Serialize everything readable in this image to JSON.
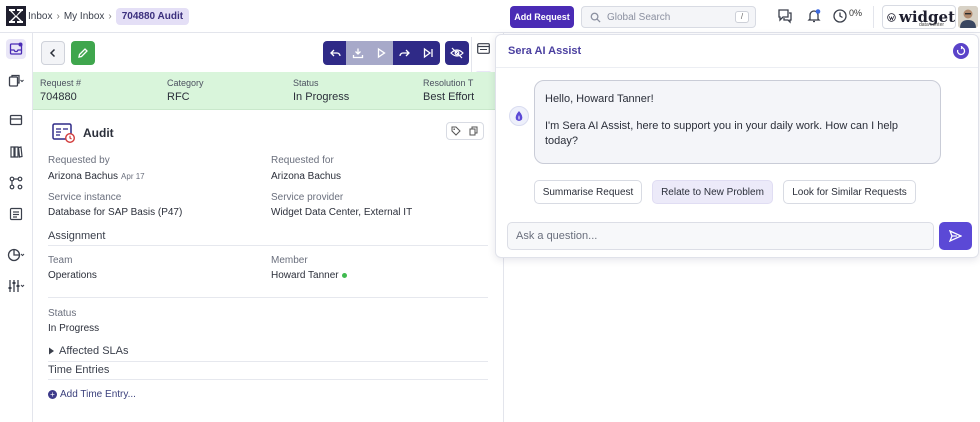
{
  "topbar": {
    "breadcrumbs": [
      "Inbox",
      "My Inbox"
    ],
    "current_ticket": "704880  Audit",
    "add_request_label": "Add Request",
    "search_placeholder": "Global Search",
    "search_shortcut": "/",
    "progress_pct": "0%",
    "brand_name": "widget",
    "brand_sub": "data center",
    "icons": [
      "chat-icon",
      "bell-icon",
      "clock-icon"
    ]
  },
  "rail": {
    "items": [
      "inbox-icon",
      "copy-icon",
      "cards-icon",
      "book-icon",
      "workflow-icon",
      "list-icon",
      "chart-icon",
      "sliders-icon"
    ]
  },
  "summary": {
    "request_label": "Request #",
    "request_value": "704880",
    "category_label": "Category",
    "category_value": "RFC",
    "status_label": "Status",
    "status_value": "In Progress",
    "resolution_label": "Resolution T",
    "resolution_value": "Best Effort"
  },
  "detail": {
    "title": "Audit",
    "requested_by_label": "Requested by",
    "requested_by_value": "Arizona Bachus",
    "requested_by_date": "Apr 17",
    "requested_for_label": "Requested for",
    "requested_for_value": "Arizona Bachus",
    "service_instance_label": "Service instance",
    "service_instance_value": "Database for SAP Basis (P47)",
    "service_provider_label": "Service provider",
    "service_provider_value": "Widget Data Center, External IT",
    "assignment_title": "Assignment",
    "team_label": "Team",
    "team_value": "Operations",
    "member_label": "Member",
    "member_value": "Howard Tanner",
    "status_label": "Status",
    "status_value": "In Progress",
    "affected_slas": "Affected SLAs",
    "time_entries": "Time Entries",
    "add_time_entry": "Add Time Entry..."
  },
  "sera": {
    "title": "Sera AI Assist",
    "greeting": "Hello, Howard Tanner!",
    "intro": "I'm Sera AI Assist, here to support you in your daily work. How can I help today?",
    "chips": [
      "Summarise Request",
      "Relate to New Problem",
      "Look for Similar Requests"
    ],
    "ask_placeholder": "Ask a question..."
  },
  "colors": {
    "accent": "#4a2bb5",
    "action_bar": "#2f2a87",
    "edit_green": "#3fa64d",
    "summary_bg": "#d9f5db",
    "online": "#3fba4f"
  }
}
